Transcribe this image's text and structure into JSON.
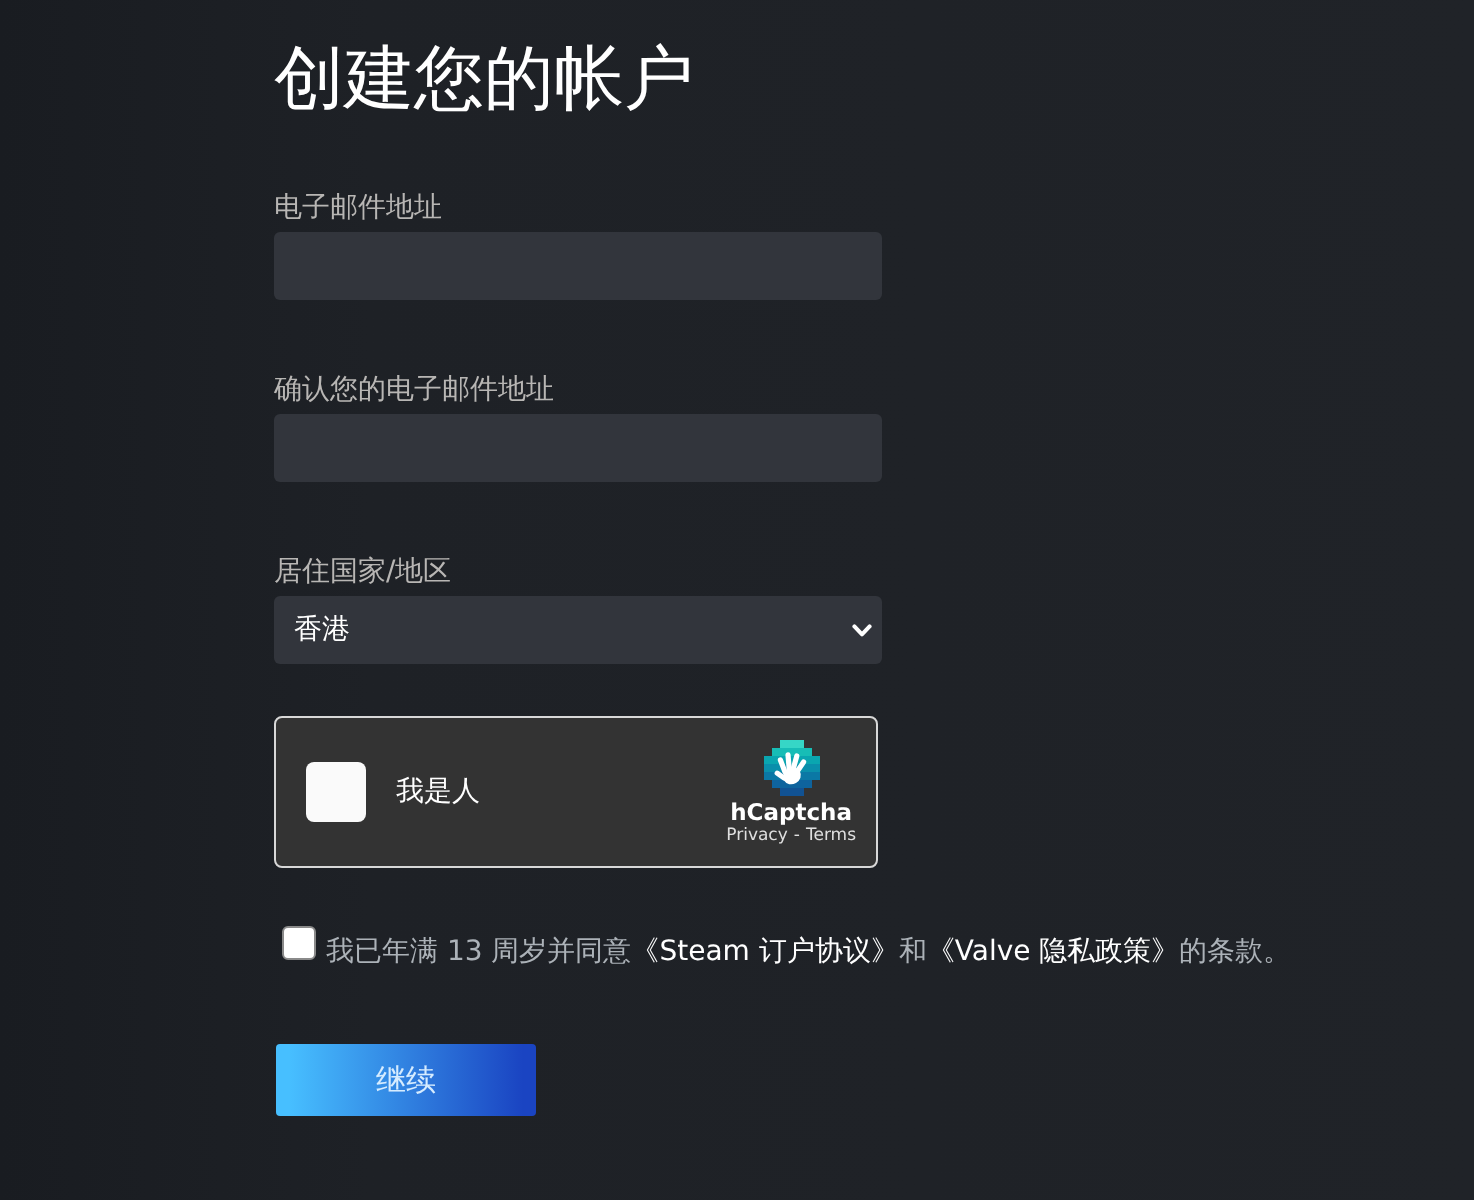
{
  "page": {
    "title": "创建您的帐户"
  },
  "fields": [
    {
      "kind": "text",
      "label": "电子邮件地址"
    },
    {
      "kind": "text",
      "label": "确认您的电子邮件地址"
    },
    {
      "kind": "select",
      "label": "居住国家/地区",
      "value": "香港"
    }
  ],
  "captcha": {
    "checked": false,
    "label": "我是人",
    "brand": "hCaptcha",
    "privacy_link": "Privacy",
    "separator": "-",
    "terms_link": "Terms"
  },
  "agreement": {
    "checked": false,
    "segments": [
      {
        "kind": "text",
        "text": "我已年满 13 周岁并同意"
      },
      {
        "kind": "link",
        "text": "《Steam 订户协议》"
      },
      {
        "kind": "text",
        "text": "和"
      },
      {
        "kind": "link",
        "text": "《Valve 隐私政策》"
      },
      {
        "kind": "text",
        "text": "的条款。"
      }
    ]
  },
  "continue_button": {
    "label": "继续"
  }
}
